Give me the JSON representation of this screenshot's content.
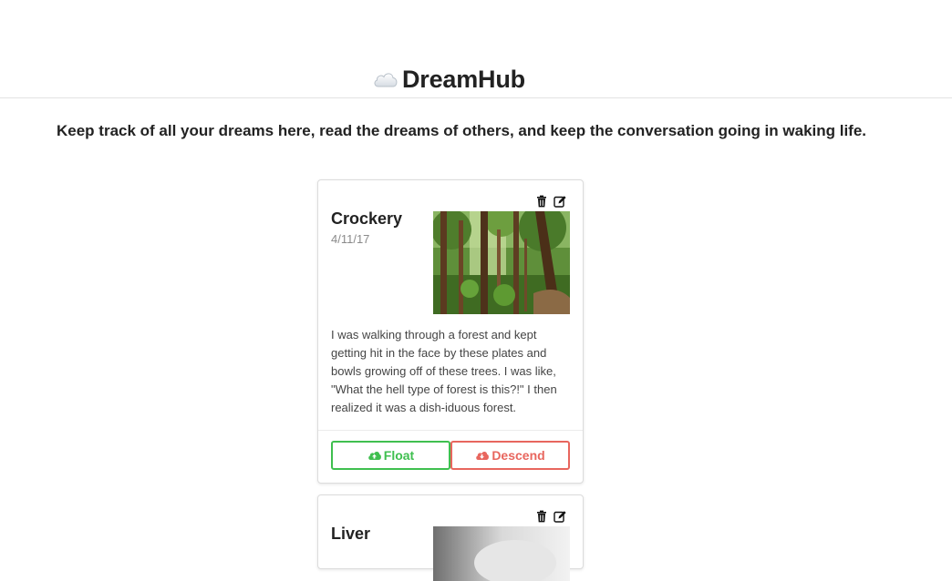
{
  "header": {
    "logo_icon": "cloud-icon",
    "brand": "DreamHub"
  },
  "tagline": "Keep track of all your dreams here, read the dreams of others, and keep the conversation going in waking life.",
  "colors": {
    "float": "#3fbf4f",
    "descend": "#e8665e"
  },
  "dreams": [
    {
      "title": "Crockery",
      "date": "4/11/17",
      "image": "forest-photo",
      "text": "I was walking through a forest and kept getting hit in the face by these plates and bowls growing off of these trees. I was like, \"What the hell type of forest is this?!\" I then realized it was a dish-iduous forest.",
      "float_label": "Float",
      "descend_label": "Descend",
      "icons": [
        "trash-icon",
        "edit-icon"
      ]
    },
    {
      "title": "Liver",
      "image": "liver-photo",
      "icons": [
        "trash-icon",
        "edit-icon"
      ]
    }
  ]
}
